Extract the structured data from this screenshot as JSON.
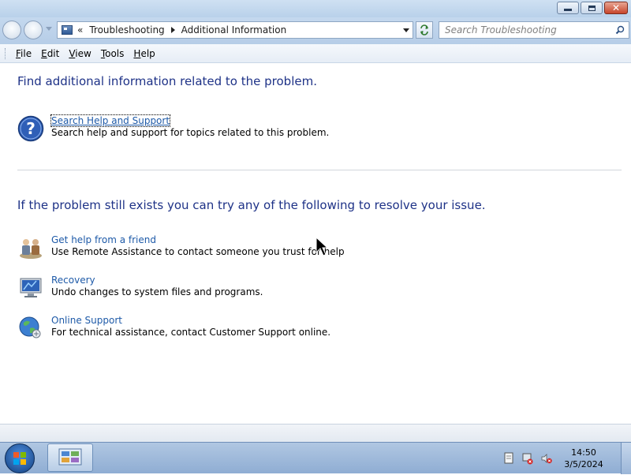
{
  "window": {
    "minimize_label": "minimize",
    "maximize_label": "maximize",
    "close_label": "close"
  },
  "address_bar": {
    "overflow_marker": "«",
    "breadcrumbs": [
      "Troubleshooting",
      "Additional Information"
    ]
  },
  "search": {
    "placeholder": "Search Troubleshooting"
  },
  "menu": {
    "items": [
      {
        "underline": "F",
        "rest": "ile"
      },
      {
        "underline": "E",
        "rest": "dit"
      },
      {
        "underline": "V",
        "rest": "iew"
      },
      {
        "underline": "T",
        "rest": "ools"
      },
      {
        "underline": "H",
        "rest": "elp"
      }
    ]
  },
  "content": {
    "section1_heading": "Find additional information related to the problem.",
    "help_task": {
      "link": "Search Help and Support",
      "description": "Search help and support for topics related to this problem."
    },
    "section2_heading": "If the problem still exists you can try any of the following to resolve your issue.",
    "tasks": [
      {
        "icon": "remote-assistance-icon",
        "link": "Get help from a friend",
        "description": "Use Remote Assistance to contact someone you trust for help"
      },
      {
        "icon": "recovery-icon",
        "link": "Recovery",
        "description": "Undo changes to system files and programs."
      },
      {
        "icon": "online-support-icon",
        "link": "Online Support",
        "description": "For technical assistance, contact Customer Support online."
      }
    ]
  },
  "taskbar": {
    "clock_time": "14:50",
    "clock_date": "3/5/2024"
  }
}
